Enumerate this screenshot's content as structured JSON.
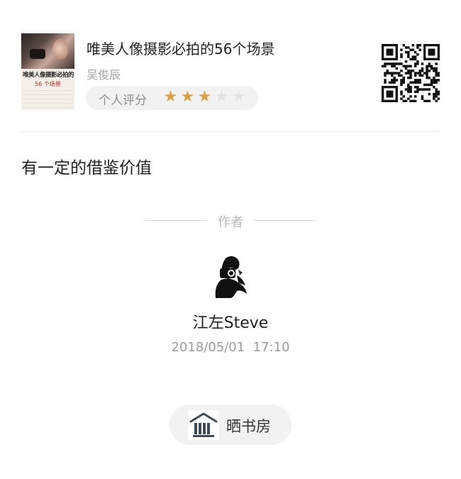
{
  "book": {
    "title": "唯美人像摄影必拍的56个场景",
    "author": "吴俊辰",
    "cover_title": "唯美人像摄影必拍的",
    "cover_subtitle": "56 个场景",
    "rating_label": "个人评分",
    "rating": 3,
    "rating_max": 5
  },
  "review": {
    "text": "有一定的借鉴价值"
  },
  "author_section": {
    "heading": "作者",
    "name": "江左Steve",
    "timestamp": "2018/05/01  17:10"
  },
  "share": {
    "button_label": "晒书房"
  },
  "colors": {
    "star_on": "#d9a245",
    "star_off": "#e3e3e3",
    "pill_background": "#f2f2f2"
  },
  "icons": {
    "qr": "qr-code-icon",
    "shelf": "bookshelf-icon",
    "star": "star-icon"
  }
}
